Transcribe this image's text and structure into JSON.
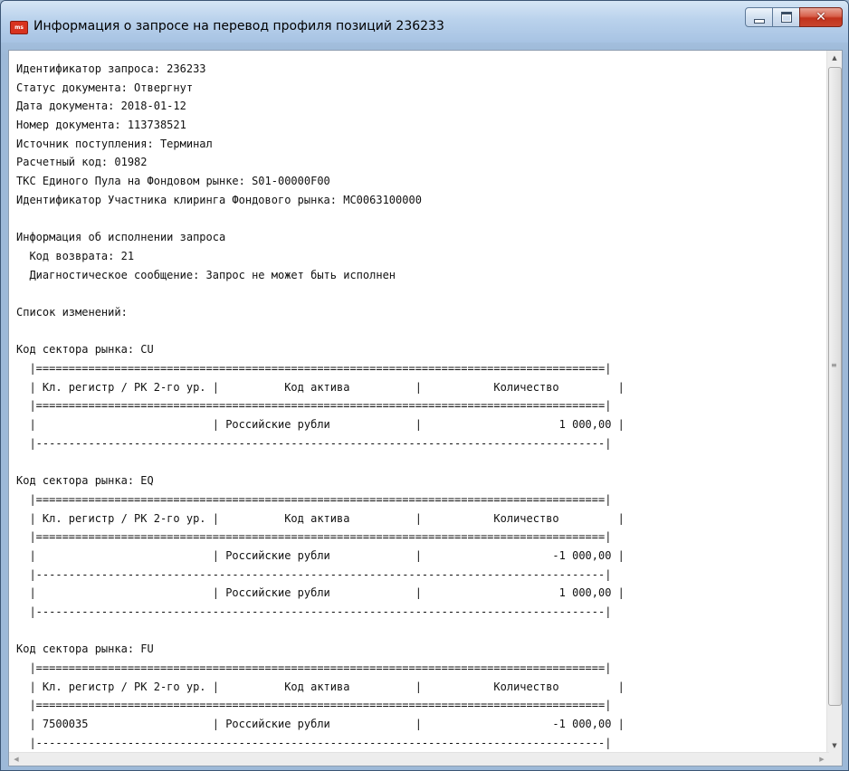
{
  "window": {
    "title": "Информация о запросе на перевод профиля позиций 236233",
    "icon": "app-logo-icon",
    "controls": {
      "minimize": "minimize-icon",
      "maximize": "maximize-icon",
      "close": "close-icon"
    },
    "close_color": "#c8442d"
  },
  "content": {
    "lines": [
      "Идентификатор запроса: 236233",
      "Статус документа: Отвергнут",
      "Дата документа: 2018-01-12",
      "Номер документа: 113738521",
      "Источник поступления: Терминал",
      "Расчетный код: 01982",
      "ТКС Единого Пула на Фондовом рынке: S01-00000F00",
      "Идентификатор Участника клиринга Фондового рынка: MC0063100000",
      "",
      "Информация об исполнении запроса",
      "  Код возврата: 21",
      "  Диагностическое сообщение: Запрос не может быть исполнен",
      "",
      "Список изменений:",
      "",
      "Код сектора рынка: CU",
      "  |=======================================================================================|",
      "  | Кл. регистр / РК 2-го ур. |          Код актива          |           Количество         |",
      "  |=======================================================================================|",
      "  |                           | Российские рубли             |                     1 000,00 |",
      "  |---------------------------------------------------------------------------------------|",
      "",
      "Код сектора рынка: EQ",
      "  |=======================================================================================|",
      "  | Кл. регистр / РК 2-го ур. |          Код актива          |           Количество         |",
      "  |=======================================================================================|",
      "  |                           | Российские рубли             |                    -1 000,00 |",
      "  |---------------------------------------------------------------------------------------|",
      "  |                           | Российские рубли             |                     1 000,00 |",
      "  |---------------------------------------------------------------------------------------|",
      "",
      "Код сектора рынка: FU",
      "  |=======================================================================================|",
      "  | Кл. регистр / РК 2-го ур. |          Код актива          |           Количество         |",
      "  |=======================================================================================|",
      "  | 7500035                   | Российские рубли             |                    -1 000,00 |",
      "  |---------------------------------------------------------------------------------------|"
    ]
  },
  "scrollbars": {
    "vertical": {
      "up": "scroll-up-arrow-icon",
      "down": "scroll-down-arrow-icon",
      "grip": "grip-icon"
    },
    "horizontal": {
      "left": "scroll-left-arrow-icon",
      "right": "scroll-right-arrow-icon"
    }
  }
}
